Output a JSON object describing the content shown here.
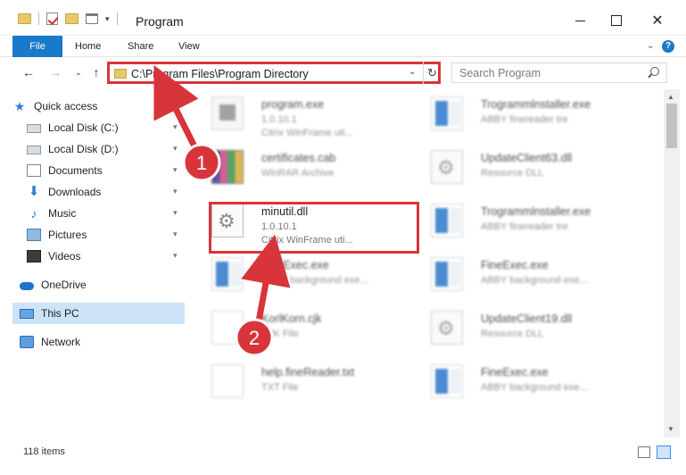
{
  "window": {
    "title": "Program",
    "controls": {
      "minimize": "",
      "maximize": "",
      "close": "✕"
    }
  },
  "ribbon": {
    "tabs": [
      {
        "label": "File",
        "active": true
      },
      {
        "label": "Home"
      },
      {
        "label": "Share"
      },
      {
        "label": "View"
      }
    ],
    "collapse": "⌄",
    "help": "?"
  },
  "nav": {
    "back": "←",
    "forward": "→",
    "recent": "⌄",
    "up": "↑",
    "address": "C:\\Program Files\\Program Directory",
    "address_dropdown": "⌄",
    "refresh": "↻",
    "search_placeholder": "Search Program"
  },
  "sidebar": {
    "items": [
      {
        "label": "Quick access",
        "icon": "star-icon"
      },
      {
        "label": "Local Disk (C:)",
        "icon": "disk-icon",
        "pinned": true
      },
      {
        "label": "Local Disk (D:)",
        "icon": "disk-icon",
        "pinned": true
      },
      {
        "label": "Documents",
        "icon": "document-icon",
        "pinned": true
      },
      {
        "label": "Downloads",
        "icon": "download-icon",
        "pinned": true
      },
      {
        "label": "Music",
        "icon": "music-icon",
        "pinned": true
      },
      {
        "label": "Pictures",
        "icon": "pictures-icon",
        "pinned": true
      },
      {
        "label": "Videos",
        "icon": "videos-icon",
        "pinned": true
      },
      {
        "label": "OneDrive",
        "icon": "cloud-icon"
      },
      {
        "label": "This PC",
        "icon": "computer-icon",
        "selected": true
      },
      {
        "label": "Network",
        "icon": "network-icon"
      }
    ],
    "pin_glyph": "📌"
  },
  "files": [
    {
      "name": "program.exe",
      "meta1": "1.0.10.1",
      "meta2": "Citrix WinFrame uti...",
      "icon": "exe-icon"
    },
    {
      "name": "Trogrammlnstaller.exe",
      "meta1": "ABBY finereader tre",
      "meta2": "",
      "icon": "app-icon"
    },
    {
      "name": "certificates.cab",
      "meta1": "WinRAR Archive",
      "meta2": "",
      "icon": "rar-icon"
    },
    {
      "name": "UpdateClient63.dll",
      "meta1": "Resource DLL",
      "meta2": "",
      "icon": "dll-icon"
    },
    {
      "name": "minutil.dll",
      "meta1": "1.0.10.1",
      "meta2": "Citrix WinFrame uti...",
      "icon": "dll-icon"
    },
    {
      "name": "Trogrammlnstaller.exe",
      "meta1": "ABBY finereader tre",
      "meta2": "",
      "icon": "app-icon"
    },
    {
      "name": "FineExec.exe",
      "meta1": "ABBY background exe...",
      "meta2": "",
      "icon": "app-icon"
    },
    {
      "name": "FineExec.exe",
      "meta1": "ABBY background exe...",
      "meta2": "",
      "icon": "app-icon"
    },
    {
      "name": "KorlKorn.cjk",
      "meta1": "CJK File",
      "meta2": "",
      "icon": "doc-icon"
    },
    {
      "name": "UpdateClient19.dll",
      "meta1": "Resource DLL",
      "meta2": "",
      "icon": "dll-icon"
    },
    {
      "name": "help.fineReader.txt",
      "meta1": "TXT File",
      "meta2": "",
      "icon": "txt-icon"
    },
    {
      "name": "FineExec.exe",
      "meta1": "ABBY background exe...",
      "meta2": "",
      "icon": "app-icon"
    }
  ],
  "status": {
    "item_count": "118 items"
  },
  "annotations": {
    "step1": "1",
    "step2": "2",
    "color": "#d8353a"
  }
}
